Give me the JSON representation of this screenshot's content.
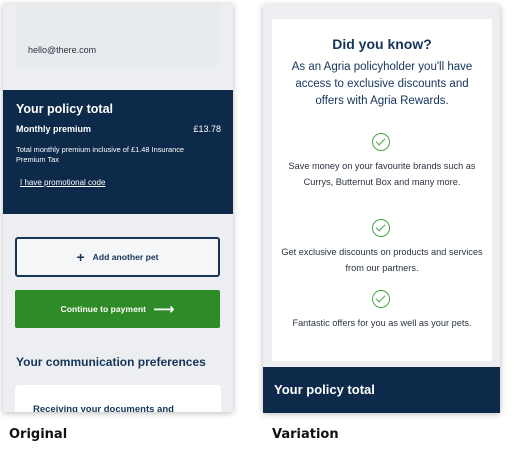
{
  "original": {
    "caption": "Original",
    "email": "hello@there.com",
    "policy_total": {
      "title": "Your policy total",
      "premium_label": "Monthly premium",
      "premium_value": "£13.78",
      "premium_note": "Total monthly premium inclusive of £1.48 Insurance Premium Tax",
      "promo_link": "I have promotional code"
    },
    "add_pet_button": {
      "icon": "plus-icon",
      "label": "Add another pet"
    },
    "continue_button": {
      "label": "Continue to payment",
      "icon": "arrow-right-icon"
    },
    "communication": {
      "title": "Your communication preferences",
      "card_title": "Receiving your documents and"
    }
  },
  "variation": {
    "caption": "Variation",
    "title": "Did you know?",
    "intro": "As an Agria policyholder you'll have access to exclusive discounts and offers with Agria Rewards.",
    "benefits": [
      {
        "icon": "check-circle-icon",
        "text": "Save money on your favourite brands such as Currys, Butternut Box and many more."
      },
      {
        "icon": "check-circle-icon",
        "text": "Get exclusive discounts on products and services from our partners."
      },
      {
        "icon": "check-circle-icon",
        "text": "Fantastic offers for you as well as your pets."
      }
    ],
    "policy_total_title": "Your policy total"
  },
  "colors": {
    "navy": "#0d2a4a",
    "heading_navy": "#15355a",
    "green_button": "#2f8a28",
    "check_green": "#48a544",
    "phone_background": "#eceef1"
  }
}
